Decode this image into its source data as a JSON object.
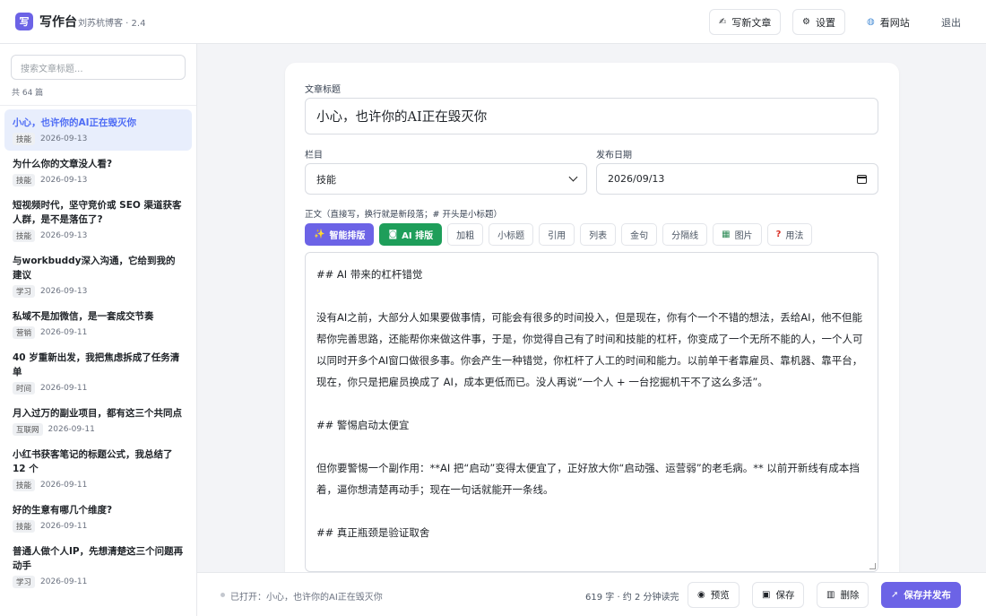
{
  "header": {
    "logo_char": "写",
    "title": "写作台",
    "subtitle": "刘苏杭博客 · 2.4",
    "new_post_label": "写新文章",
    "settings_label": "设置",
    "view_site_label": "看网站",
    "logout_label": "退出"
  },
  "sidebar": {
    "search_placeholder": "搜索文章标题...",
    "count_text": "共 64 篇",
    "items": [
      {
        "title": "小心，也许你的AI正在毁灭你",
        "tag": "技能",
        "date": "2026-09-13"
      },
      {
        "title": "为什么你的文章没人看?",
        "tag": "技能",
        "date": "2026-09-13"
      },
      {
        "title": "短视频时代，坚守竞价或 SEO 渠道获客人群，是不是落伍了?",
        "tag": "技能",
        "date": "2026-09-13"
      },
      {
        "title": "与workbuddy深入沟通，它给到我的建议",
        "tag": "学习",
        "date": "2026-09-13"
      },
      {
        "title": "私域不是加微信，是一套成交节奏",
        "tag": "营销",
        "date": "2026-09-11"
      },
      {
        "title": "40 岁重新出发，我把焦虑拆成了任务清单",
        "tag": "时间",
        "date": "2026-09-11"
      },
      {
        "title": "月入过万的副业项目，都有这三个共同点",
        "tag": "互联网",
        "date": "2026-09-11"
      },
      {
        "title": "小红书获客笔记的标题公式，我总结了 12 个",
        "tag": "技能",
        "date": "2026-09-11"
      },
      {
        "title": "好的生意有哪几个维度?",
        "tag": "技能",
        "date": "2026-09-11"
      },
      {
        "title": "普通人做个人IP，先想清楚这三个问题再动手",
        "tag": "学习",
        "date": "2026-09-11"
      }
    ]
  },
  "editor": {
    "title_label": "文章标题",
    "title_value": "小心，也许你的AI正在毁灭你",
    "category_label": "栏目",
    "category_value": "技能",
    "date_label": "发布日期",
    "date_value": "2026/09/13",
    "body_label": "正文（直接写，换行就是新段落；# 开头是小标题）",
    "toolbar": {
      "smart_format": "智能排版",
      "ai_format": "AI 排版",
      "bold": "加粗",
      "subheading": "小标题",
      "quote": "引用",
      "list": "列表",
      "golden": "金句",
      "divider": "分隔线",
      "image": "图片",
      "help": "用法"
    },
    "content": [
      "## AI 带来的杠杆错觉",
      "没有AI之前，大部分人如果要做事情，可能会有很多的时间投入，但是现在，你有个一个不错的想法，丢给AI，他不但能帮你完善思路，还能帮你来做这件事，于是，你觉得自己有了时间和技能的杠杆，你变成了一个无所不能的人，一个人可以同时开多个AI窗口做很多事。你会产生一种错觉，你杠杆了人工的时间和能力。以前单干者靠雇员、靠机器、靠平台，现在，你只是把雇员换成了 AI，成本更低而已。没人再说“一个人 + 一台挖掘机干不了这么多活”。",
      "## 警惕启动太便宜",
      "但你要警惕一个副作用：**AI 把“启动”变得太便宜了，正好放大你“启动强、运营弱”的老毛病。** 以前开新线有成本挡着，逼你想清楚再动手；现在一句话就能开一条线。",
      "## 真正瓶颈是验证取舍"
    ]
  },
  "statusbar": {
    "opened_text": "已打开：小心，也许你的AI正在毁灭你",
    "word_count": "619 字 · 约 2 分钟读完",
    "preview_label": "预览",
    "save_label": "保存",
    "delete_label": "删除",
    "publish_label": "保存并发布"
  },
  "colors": {
    "accent": "#6c63e6",
    "ai_green": "#1e9e5a",
    "active_item_bg": "#e8eefc",
    "active_item_text": "#4f6df5"
  }
}
